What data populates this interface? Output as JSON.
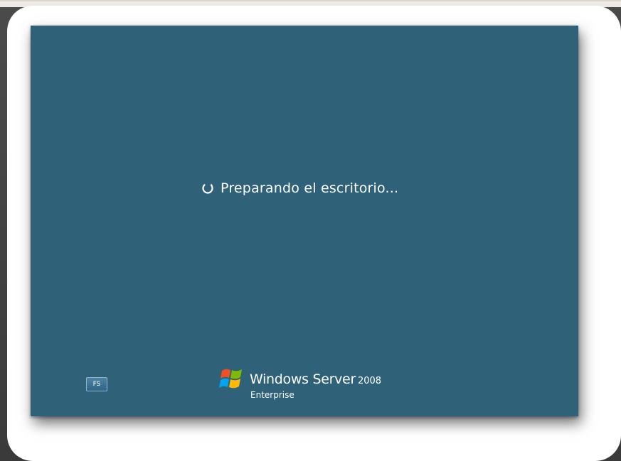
{
  "boot_screen": {
    "status_text": "Preparando el escritorio...",
    "spinner_icon": "loading-spinner-icon",
    "language_button_label": "FS",
    "brand": {
      "product_name": "Windows Server",
      "product_year": "2008",
      "edition": "Enterprise",
      "logo_icon": "windows-flag-icon"
    },
    "colors": {
      "screen_background": "#2f6279",
      "text": "#ffffff",
      "page_background": "#ede9e4",
      "card": "#ffffff"
    }
  }
}
